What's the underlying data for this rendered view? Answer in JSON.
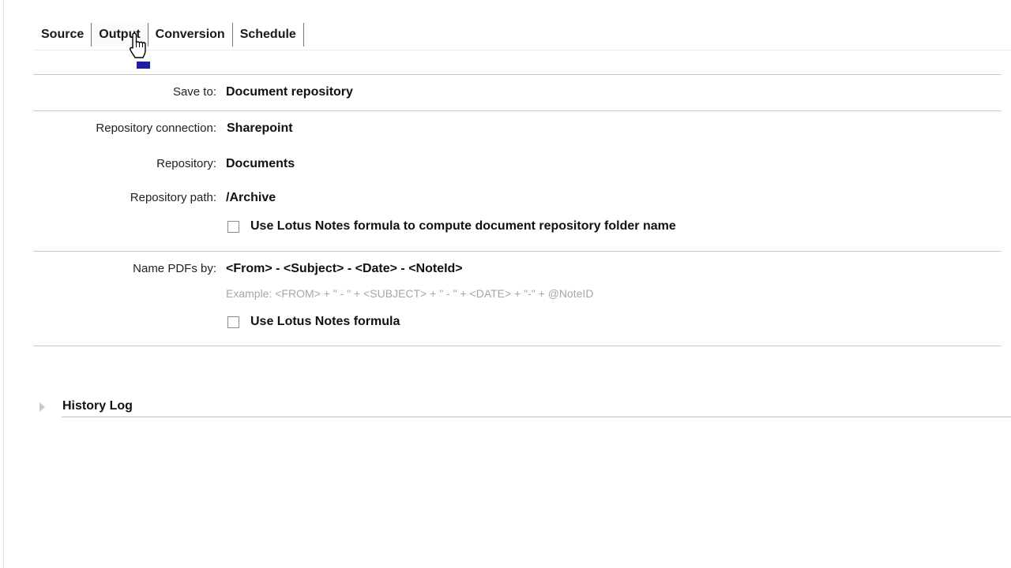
{
  "tabs": [
    {
      "label": "Source"
    },
    {
      "label": "Output"
    },
    {
      "label": "Conversion"
    },
    {
      "label": "Schedule"
    }
  ],
  "active_tab": "Output",
  "output": {
    "save_to_label": "Save to:",
    "save_to_value": "Document repository",
    "repository_connection_label": "Repository connection:",
    "repository_connection_value": "Sharepoint",
    "repository_label": "Repository:",
    "repository_value": "Documents",
    "repository_path_label": "Repository path:",
    "repository_path_value": "/Archive",
    "folder_formula_label": "Use Lotus Notes formula to compute document repository folder name",
    "name_pdfs_label": "Name PDFs by:",
    "name_pdfs_value": "<From> - <Subject> - <Date> - <NoteId>",
    "name_example": "Example: <FROM> + \" - \" + <SUBJECT> + \" - \" + <DATE> + \"-\" + @NoteID",
    "name_formula_label": "Use Lotus Notes formula"
  },
  "history": {
    "title": "History Log"
  },
  "colors": {
    "separator": "#c8c8c8",
    "example_text": "#a6a6a6",
    "cursor_accent": "#1c1ca8"
  },
  "icons": {
    "cursor": "hand-pointer-icon",
    "expander": "triangle-right-icon"
  }
}
